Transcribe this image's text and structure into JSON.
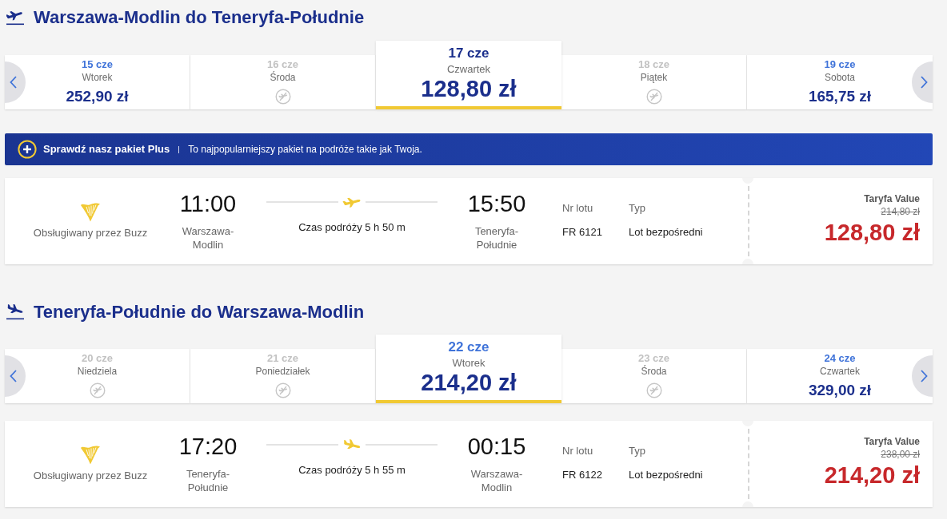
{
  "sections": [
    {
      "kind": "outbound",
      "title": "Warszawa-Modlin do Teneryfa-Południe",
      "days": [
        {
          "date": "15 cze",
          "weekday": "Wtorek",
          "price": "252,90 zł",
          "available": true,
          "selected": false,
          "color": "#3f73d9"
        },
        {
          "date": "16 cze",
          "weekday": "Środa",
          "available": false,
          "selected": false,
          "color": "#c2c2c2"
        },
        {
          "date": "17 cze",
          "weekday": "Czwartek",
          "price": "128,80 zł",
          "available": true,
          "selected": true,
          "color": "#1b2f8c"
        },
        {
          "date": "18 cze",
          "weekday": "Piątek",
          "available": false,
          "selected": false,
          "color": "#c2c2c2"
        },
        {
          "date": "19 cze",
          "weekday": "Sobota",
          "price": "165,75 zł",
          "available": true,
          "selected": false,
          "color": "#3f73d9"
        }
      ],
      "banner": {
        "title": "Sprawdź nasz pakiet Plus",
        "text": "To najpopularniejszy pakiet na podróże takie jak Twoja."
      },
      "flight": {
        "operator": "Obsługiwany przez Buzz",
        "departure_time": "11:00",
        "departure_airport": "Warszawa-Modlin",
        "duration": "Czas podróży 5 h 50 m",
        "arrival_time": "15:50",
        "arrival_airport": "Teneryfa-Południe",
        "flight_number_label": "Nr lotu",
        "flight_number": "FR 6121",
        "type_label": "Typ",
        "type": "Lot bezpośredni",
        "fare_name": "Taryfa Value",
        "old_price": "214,80 zł",
        "price": "128,80 zł"
      }
    },
    {
      "kind": "inbound",
      "title": "Teneryfa-Południe do Warszawa-Modlin",
      "days": [
        {
          "date": "20 cze",
          "weekday": "Niedziela",
          "available": false,
          "selected": false,
          "color": "#c2c2c2"
        },
        {
          "date": "21 cze",
          "weekday": "Poniedziałek",
          "available": false,
          "selected": false,
          "color": "#c2c2c2"
        },
        {
          "date": "22 cze",
          "weekday": "Wtorek",
          "price": "214,20 zł",
          "available": true,
          "selected": true,
          "color": "#3f73d9"
        },
        {
          "date": "23 cze",
          "weekday": "Środa",
          "available": false,
          "selected": false,
          "color": "#c2c2c2"
        },
        {
          "date": "24 cze",
          "weekday": "Czwartek",
          "price": "329,00 zł",
          "available": true,
          "selected": false,
          "color": "#3f73d9"
        }
      ],
      "flight": {
        "operator": "Obsługiwany przez Buzz",
        "departure_time": "17:20",
        "departure_airport": "Teneryfa-Południe",
        "duration": "Czas podróży 5 h 55 m",
        "arrival_time": "00:15",
        "arrival_airport": "Warszawa-Modlin",
        "flight_number_label": "Nr lotu",
        "flight_number": "FR 6122",
        "type_label": "Typ",
        "type": "Lot bezpośredni",
        "fare_name": "Taryfa Value",
        "old_price": "238,00 zł",
        "price": "214,20 zł"
      }
    }
  ]
}
